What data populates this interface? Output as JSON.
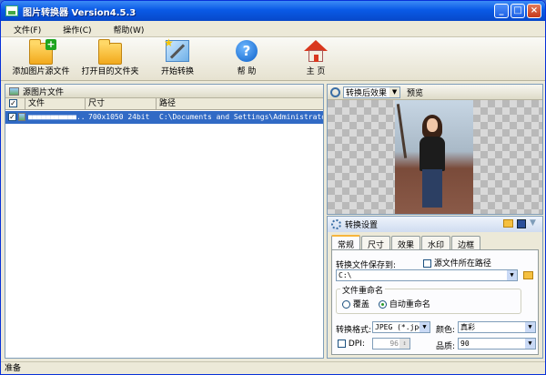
{
  "window": {
    "title": "图片转换器 Version4.5.3",
    "buttons": {
      "minimize": "_",
      "maximize": "□",
      "close": "×"
    }
  },
  "menu": [
    "文件(F)",
    "操作(C)",
    "帮助(W)"
  ],
  "toolbar": {
    "add": "添加图片源文件",
    "open": "打开目的文件夹",
    "start": "开始转换",
    "help": "帮 助",
    "home": "主 页",
    "help_glyph": "?"
  },
  "source": {
    "title": "源图片文件",
    "columns": [
      "文件",
      "尺寸",
      "路径"
    ],
    "rows": [
      {
        "file": "■■■■■■■■■■■...",
        "size": "700x1050  24bit",
        "path": "C:\\Documents and Settings\\Administrator..."
      }
    ]
  },
  "preview": {
    "effect_select": "转换后效果",
    "label": "预览"
  },
  "settings": {
    "title": "转换设置",
    "tabs": [
      "常规",
      "尺寸",
      "效果",
      "水印",
      "边框"
    ],
    "save_to_label": "转换文件保存到:",
    "source_path_label": "源文件所在路径",
    "save_path": "C:\\",
    "rename_group": "文件重命名",
    "rename_overwrite": "覆盖",
    "rename_auto": "自动重命名",
    "format_label": "转换格式:",
    "format_value": "JPEG (*.jpg",
    "color_label": "颜色:",
    "color_value": "真彩",
    "dpi_label": "DPI:",
    "dpi_value": "96",
    "quality_label": "品质:",
    "quality_value": "90"
  },
  "status": "准备"
}
